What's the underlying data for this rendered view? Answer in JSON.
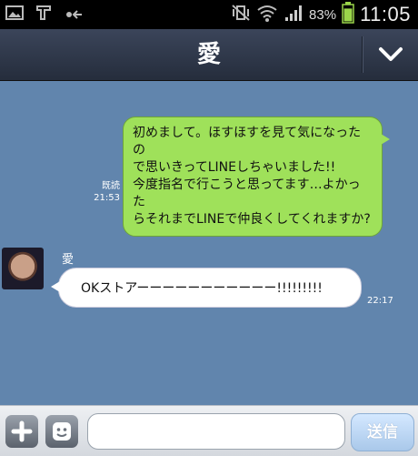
{
  "status_bar": {
    "battery_percent": "83%",
    "time": "11:05",
    "battery_level": 0.83
  },
  "header": {
    "title": "愛"
  },
  "messages": [
    {
      "direction": "outgoing",
      "text_lines": [
        "初めまして。ほすほすを見て気になったの",
        "で思いきってLINEしちゃいました!!",
        "今度指名で行こうと思ってます…よかった",
        "らそれまでLINEで仲良くしてくれますか?"
      ],
      "read_label": "既読",
      "time": "21:53"
    },
    {
      "direction": "incoming",
      "sender": "愛",
      "text": "OKストアーーーーーーーーーーー!!!!!!!!!",
      "time": "22:17"
    }
  ],
  "input_bar": {
    "placeholder": "",
    "send_label": "送信"
  },
  "colors": {
    "chat_bg": "#6185ad",
    "outgoing_bubble": "#9fe15a",
    "incoming_bubble": "#ffffff"
  }
}
